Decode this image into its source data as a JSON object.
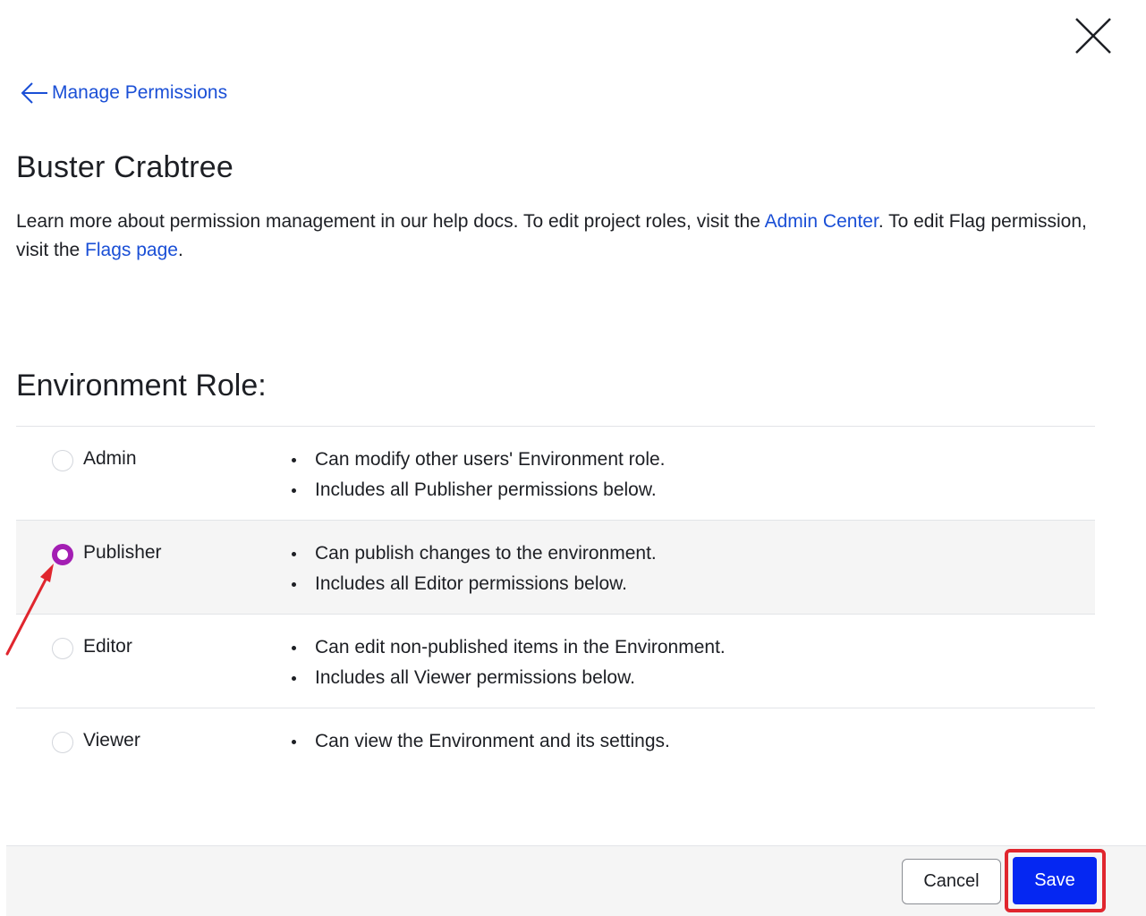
{
  "header": {
    "close_icon": "close-icon",
    "back_link_label": "Manage Permissions"
  },
  "user": {
    "name": "Buster Crabtree"
  },
  "help": {
    "part1": "Learn more about permission management in our help docs. To edit project roles, visit the ",
    "admin_center_link": "Admin Center",
    "part2": ". To edit Flag permission, visit the ",
    "flags_page_link": "Flags page",
    "part3": "."
  },
  "environment_role": {
    "title": "Environment Role:",
    "selected": "Publisher",
    "roles": [
      {
        "label": "Admin",
        "checked": false,
        "descriptions": [
          "Can modify other users' Environment role.",
          "Includes all Publisher permissions below."
        ]
      },
      {
        "label": "Publisher",
        "checked": true,
        "descriptions": [
          "Can publish changes to the environment.",
          "Includes all Editor permissions below."
        ]
      },
      {
        "label": "Editor",
        "checked": false,
        "descriptions": [
          "Can edit non-published items in the Environment.",
          "Includes all Viewer permissions below."
        ]
      },
      {
        "label": "Viewer",
        "checked": false,
        "descriptions": [
          "Can view the Environment and its settings."
        ]
      }
    ]
  },
  "footer": {
    "cancel_label": "Cancel",
    "save_label": "Save"
  },
  "colors": {
    "link": "#1a4fd6",
    "radio_checked": "#a31eb3",
    "save_button": "#0527f2",
    "annotation": "#e0262e"
  }
}
